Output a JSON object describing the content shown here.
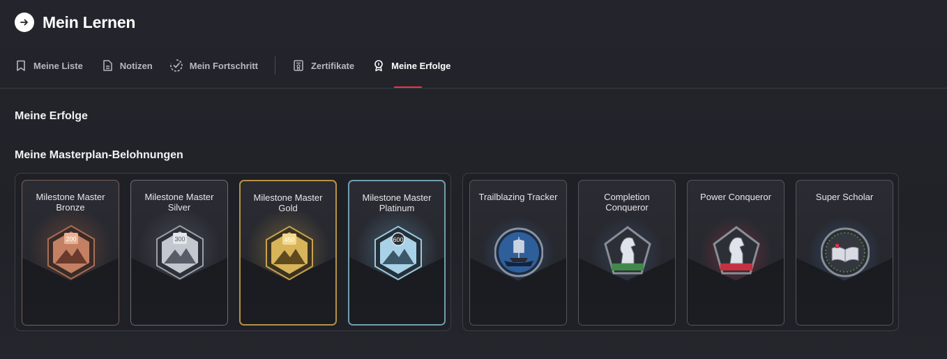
{
  "header": {
    "title": "Mein Lernen",
    "back_icon": "arrow-right-icon"
  },
  "tabs": [
    {
      "label": "Meine Liste",
      "icon": "bookmark-icon"
    },
    {
      "label": "Notizen",
      "icon": "note-icon"
    },
    {
      "label": "Mein Fortschritt",
      "icon": "progress-check-icon"
    },
    {
      "label": "Zertifikate",
      "icon": "certificate-icon"
    },
    {
      "label": "Meine Erfolge",
      "icon": "award-icon",
      "active": true
    }
  ],
  "accent_color": "#e8344d",
  "sections": {
    "achievements_title": "Meine Erfolge",
    "masterplan_title": "Meine Masterplan-Belohnungen"
  },
  "milestones": [
    {
      "title": "Milestone Master Bronze",
      "value": "200",
      "tier_color": "#c98a6a"
    },
    {
      "title": "Milestone Master Silver",
      "value": "300",
      "tier_color": "#c8ccd4"
    },
    {
      "title": "Milestone Master Gold",
      "value": "450",
      "tier_color": "#d8b45a"
    },
    {
      "title": "Milestone Master Platinum",
      "value": "600",
      "tier_color": "#a8d2e8"
    }
  ],
  "rewards": [
    {
      "title": "Trailblazing Tracker",
      "icon": "ship-icon"
    },
    {
      "title": "Completion Conqueror",
      "icon": "chess-knight-icon"
    },
    {
      "title": "Power Conqueror",
      "icon": "chess-knight-icon"
    },
    {
      "title": "Super Scholar",
      "icon": "book-icon"
    }
  ]
}
